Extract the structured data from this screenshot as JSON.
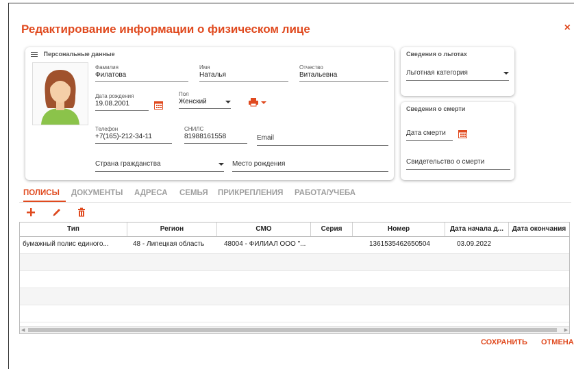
{
  "dialog": {
    "title": "Редактирование информации о физическом лице",
    "close": "×"
  },
  "personal": {
    "header": "Персональные данные",
    "surname": {
      "label": "Фамилия",
      "value": "Филатова"
    },
    "name": {
      "label": "Имя",
      "value": "Наталья"
    },
    "patronymic": {
      "label": "Отчество",
      "value": "Витальевна"
    },
    "birthdate": {
      "label": "Дата рождения",
      "value": "19.08.2001"
    },
    "gender": {
      "label": "Пол",
      "value": "Женский"
    },
    "phone": {
      "label": "Телефон",
      "value": "+7(165)-212-34-11"
    },
    "snils": {
      "label": "СНИЛС",
      "value": "81988161558"
    },
    "email": {
      "placeholder": "Email"
    },
    "citizenship": {
      "placeholder": "Страна гражданства"
    },
    "birthplace": {
      "placeholder": "Место рождения"
    }
  },
  "benefits": {
    "header": "Сведения о льготах",
    "category": "Льготная категория"
  },
  "death": {
    "header": "Сведения о смерти",
    "date_placeholder": "Дата смерти",
    "certificate_placeholder": "Свидетельство о смерти"
  },
  "tabs": [
    "ПОЛИСЫ",
    "ДОКУМЕНТЫ",
    "АДРЕСА",
    "СЕМЬЯ",
    "ПРИКРЕПЛЕНИЯ",
    "РАБОТА/УЧЕБА"
  ],
  "table": {
    "columns": [
      "Тип",
      "Регион",
      "СМО",
      "Серия",
      "Номер",
      "Дата начала д...",
      "Дата окончания"
    ],
    "rows": [
      [
        "бумажный полис единого...",
        "48 - Липецкая область",
        "48004 - ФИЛИАЛ ООО \"...",
        "",
        "1361535462650504",
        "03.09.2022",
        ""
      ]
    ]
  },
  "footer": {
    "save": "СОХРАНИТЬ",
    "cancel": "ОТМЕНА"
  },
  "colors": {
    "accent": "#e04a1f",
    "calendar": "#e04a1f",
    "add": "#e04a1f"
  }
}
